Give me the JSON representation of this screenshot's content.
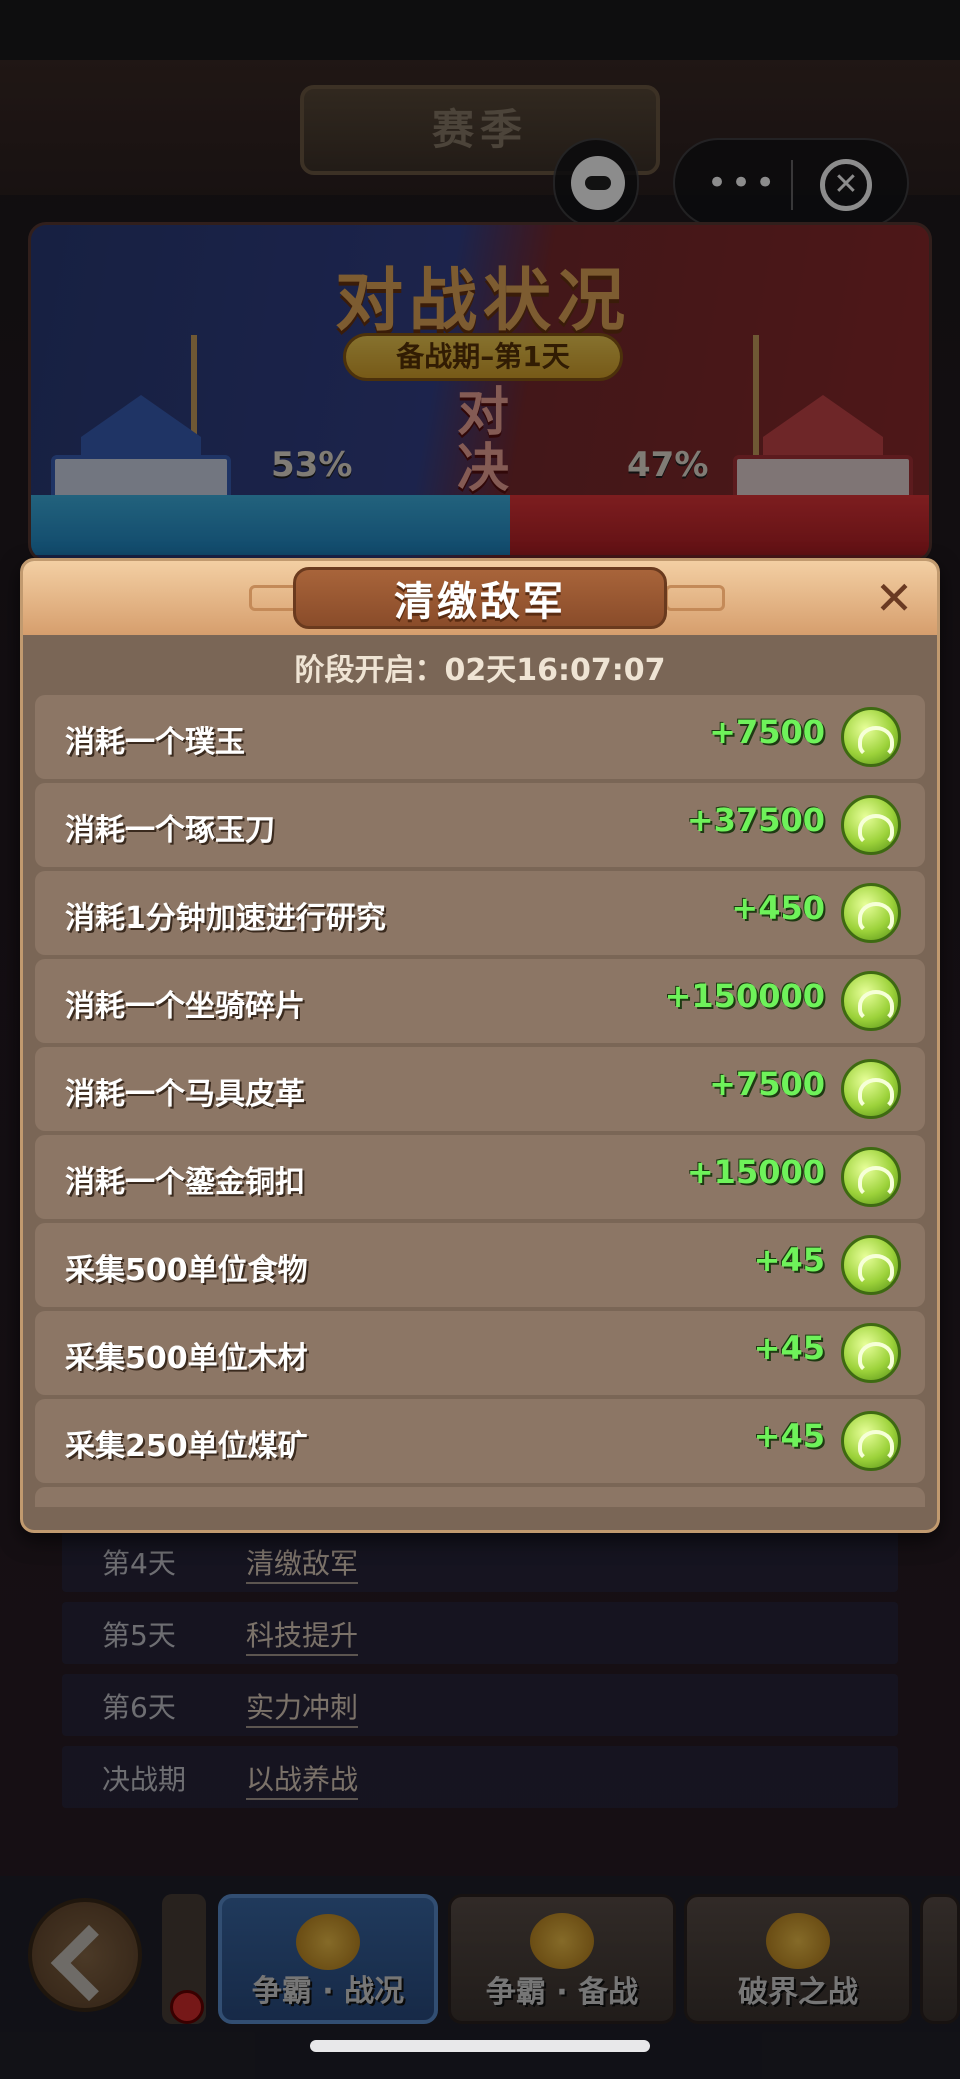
{
  "header": {
    "season_title": "赛季"
  },
  "capsule": {
    "game_icon": "gamepad-icon",
    "more_icon": "more-dots-icon",
    "close_icon": "close-circle-icon",
    "more_text": "•••",
    "close_text": "✕"
  },
  "battle": {
    "title": "对战状况",
    "phase": "备战期–第1天",
    "vs": "对决",
    "blue_percent": "53%",
    "red_percent": "47%",
    "blue_ratio": 0.53,
    "red_ratio": 0.47,
    "colors": {
      "blue": "#1f86c4",
      "red": "#b21f25"
    }
  },
  "modal": {
    "title": "清缴敌军",
    "close_text": "✕",
    "phase_open": "阶段开启：02天16:07:07",
    "reward_icon": "jade-coin-icon",
    "items": [
      {
        "label": "消耗一个璞玉",
        "points": "+7500"
      },
      {
        "label": "消耗一个琢玉刀",
        "points": "+37500"
      },
      {
        "label": "消耗1分钟加速进行研究",
        "points": "+450"
      },
      {
        "label": "消耗一个坐骑碎片",
        "points": "+150000"
      },
      {
        "label": "消耗一个马具皮革",
        "points": "+7500"
      },
      {
        "label": "消耗一个鎏金铜扣",
        "points": "+15000"
      },
      {
        "label": "采集500单位食物",
        "points": "+45"
      },
      {
        "label": "采集500单位木材",
        "points": "+45"
      },
      {
        "label": "采集250单位煤矿",
        "points": "+45"
      }
    ]
  },
  "schedule": [
    {
      "day": "第4天",
      "task": "清缴敌军"
    },
    {
      "day": "第5天",
      "task": "科技提升"
    },
    {
      "day": "第6天",
      "task": "实力冲刺"
    },
    {
      "day": "决战期",
      "task": "以战养战"
    }
  ],
  "bottom_tabs": [
    {
      "label": "争霸 · 战况",
      "icon": "scroll-shield-icon",
      "active": true
    },
    {
      "label": "争霸 · 备战",
      "icon": "flags-icon",
      "active": false
    },
    {
      "label": "破界之战",
      "icon": "gold-star-icon",
      "active": false
    }
  ],
  "nav": {
    "back_icon": "back-arrow-icon"
  }
}
